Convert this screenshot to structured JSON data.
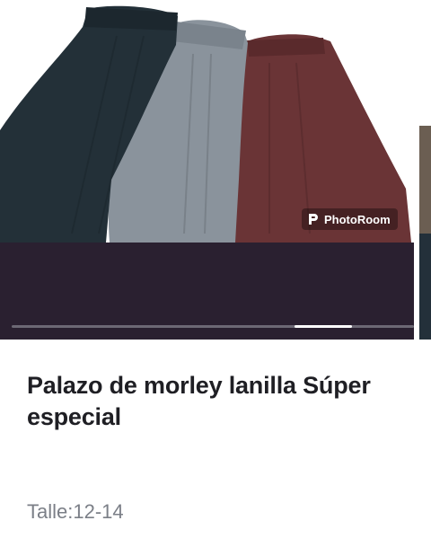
{
  "carousel": {
    "badge_label": "PhotoRoom",
    "slide_count_visible": 2,
    "active_indicator": "last",
    "colors": {
      "background": "#2a2030",
      "pant_dark": "#233038",
      "pant_light": "#8a939c",
      "pant_brown": "#6a3436"
    }
  },
  "product": {
    "title": "Palazo de morley lanilla Súper especial",
    "size_label": "Talle:12-14"
  }
}
